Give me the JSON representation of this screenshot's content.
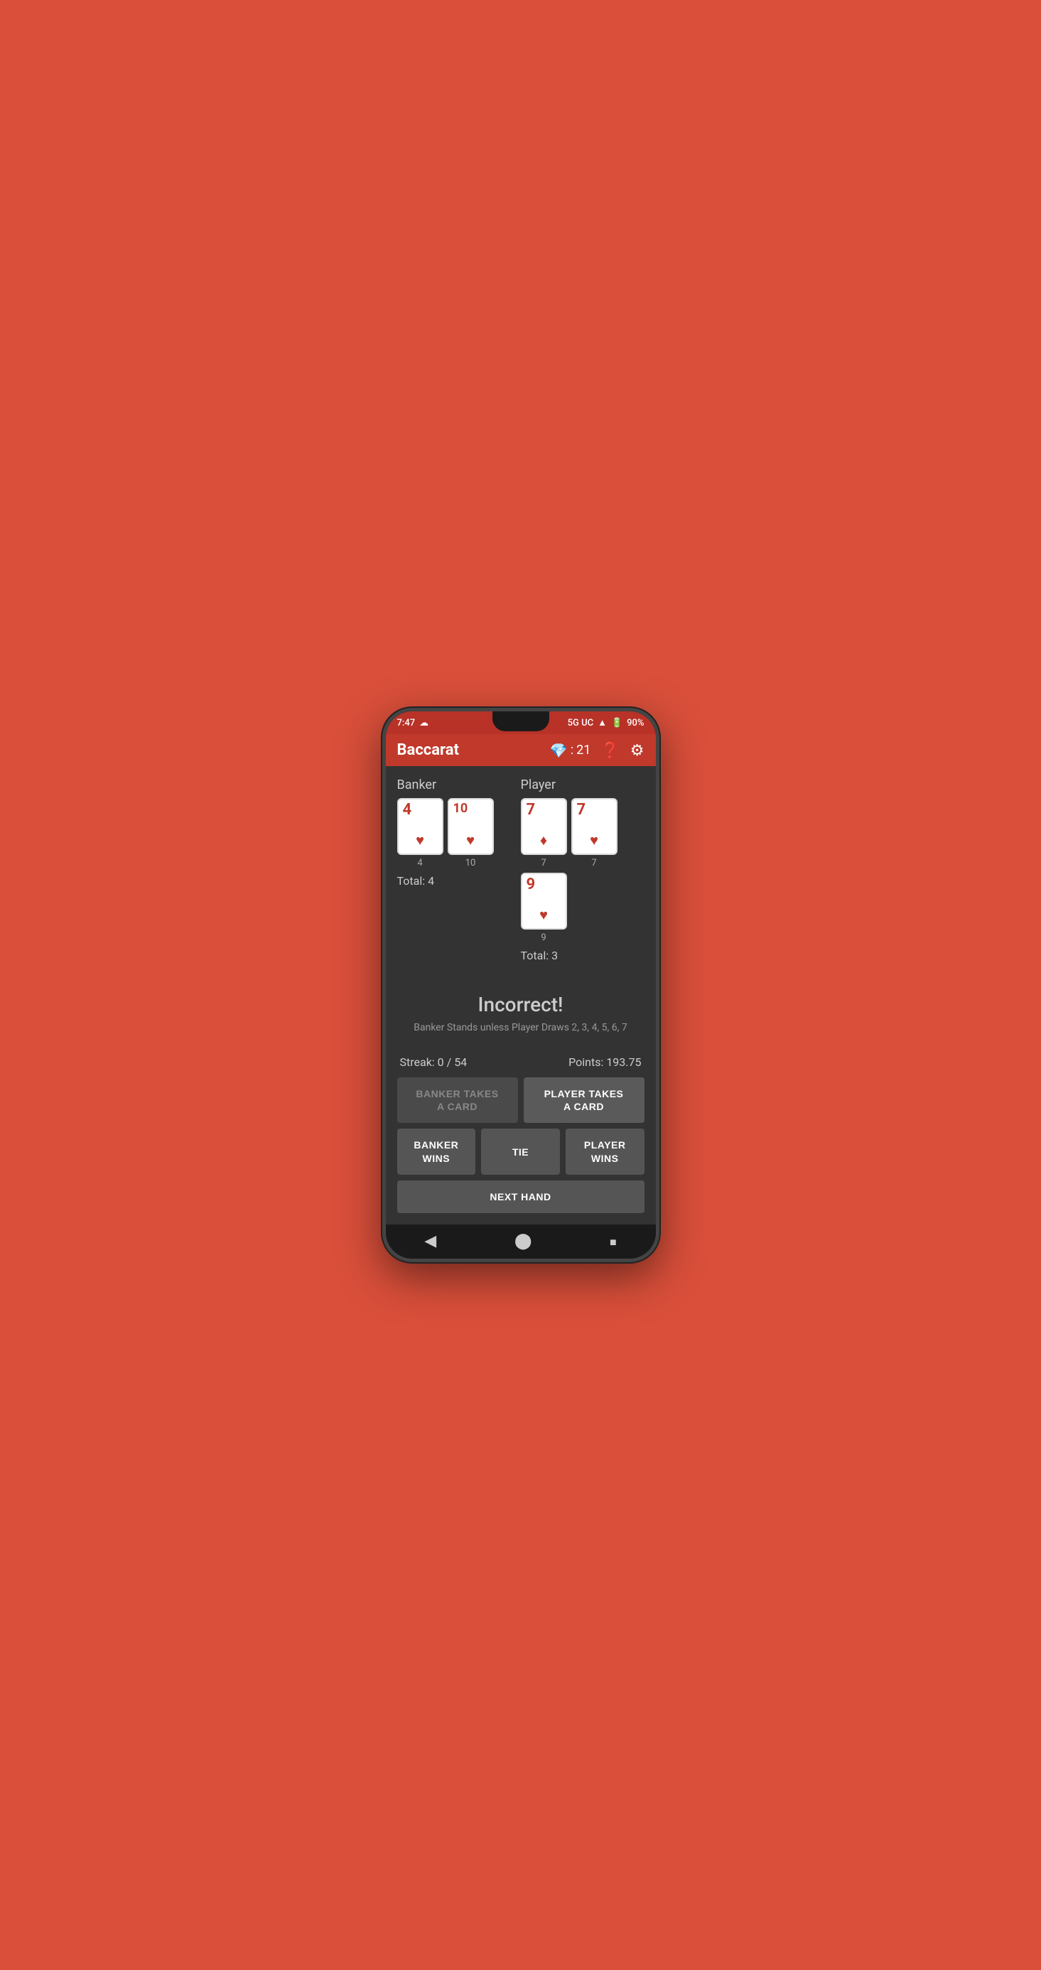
{
  "status_bar": {
    "time": "7:47",
    "network": "5G UC",
    "battery": "90%"
  },
  "app_bar": {
    "title": "Baccarat",
    "gem_score": "21",
    "help_icon": "?",
    "settings_icon": "⚙"
  },
  "banker": {
    "label": "Banker",
    "cards": [
      {
        "value": "4",
        "suit": "♥",
        "suit_type": "heart",
        "num": "4"
      },
      {
        "value": "10",
        "suit": "♥",
        "suit_type": "heart",
        "num": "10"
      }
    ],
    "total_label": "Total:",
    "total": "4"
  },
  "player": {
    "label": "Player",
    "cards": [
      {
        "value": "7",
        "suit": "♦",
        "suit_type": "diamond",
        "num": "7"
      },
      {
        "value": "7",
        "suit": "♥",
        "suit_type": "heart",
        "num": "7"
      },
      {
        "value": "9",
        "suit": "♥",
        "suit_type": "heart",
        "num": "9"
      }
    ],
    "total_label": "Total:",
    "total": "3"
  },
  "result": {
    "title": "Incorrect!",
    "subtitle": "Banker Stands unless Player Draws 2, 3, 4, 5, 6, 7"
  },
  "stats": {
    "streak_label": "Streak:",
    "streak_value": "0 / 54",
    "points_label": "Points:",
    "points_value": "193.75"
  },
  "buttons": {
    "banker_takes_card": "BANKER TAKES\nA CARD",
    "player_takes_card": "PLAYER TAKES\nA CARD",
    "banker_wins": "BANKER\nWINS",
    "tie": "TIE",
    "player_wins": "PLAYER\nWINS",
    "next_hand": "NEXT HAND"
  },
  "nav": {
    "back": "◀",
    "home": "⬤",
    "recent": "▪"
  }
}
